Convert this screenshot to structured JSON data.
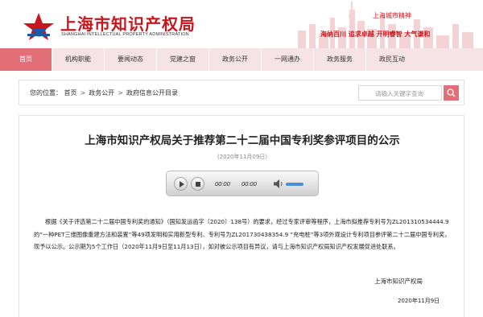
{
  "header": {
    "logo_text": "上海市知识产权局",
    "logo_sub": "SHANGHAI INTELLECTUAL PROPERTY ADMINISTRATION",
    "spirit_title": "上海城市精神",
    "spirit_line": "海纳百川  追求卓越  开明睿智  大气谦和"
  },
  "nav": {
    "items": [
      {
        "label": "首页",
        "active": true
      },
      {
        "label": "机构职能",
        "active": false
      },
      {
        "label": "要闻动态",
        "active": false
      },
      {
        "label": "党建之窗",
        "active": false
      },
      {
        "label": "政务公开",
        "active": false
      },
      {
        "label": "一网通办",
        "active": false
      },
      {
        "label": "政务服务",
        "active": false
      },
      {
        "label": "政民互动",
        "active": false
      }
    ]
  },
  "breadcrumb": {
    "prefix": "您的位置：",
    "items": [
      "首页",
      "政务公开",
      "政府信息公开目录"
    ],
    "separator": ">"
  },
  "search": {
    "placeholder": "请输入关键字查询"
  },
  "article": {
    "title": "上海市知识产权局关于推荐第二十二届中国专利奖参评项目的公示",
    "date": "(2020年11月09日)",
    "body": "根据《关于评选第二十二届中国专利奖的通知》（国知发运函字〔2020〕138号）的要求，经过专家评审等程序，上海市拟推荐专利号为ZL201310534444.9的“一种PET三维图像重建方法和装置”等49项发明和实用新型专利、专利号为ZL201730438354.9 “充电桩”等3项外观设计专利项目参评第二十二届中国专利奖，现予以公示。公示期为5个工作日（2020年11月9日至11月13日），如对被公示项目有异议，请与上海市知识产权局知识产权发展促进处联系。",
    "sign_org": "上海市知识产权局",
    "sign_date": "2020年11月9日"
  },
  "audio": {
    "current_time": "00:00",
    "duration": "00:00"
  },
  "colors": {
    "brand_red": "#c8161d",
    "nav_bg": "#f6e3e5",
    "nav_active": "#e26f78"
  }
}
